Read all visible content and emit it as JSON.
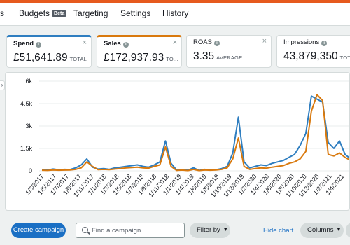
{
  "nav": {
    "items": [
      {
        "label": "s"
      },
      {
        "label": "Budgets",
        "badge": "Beta"
      },
      {
        "label": "Targeting"
      },
      {
        "label": "Settings"
      },
      {
        "label": "History"
      }
    ]
  },
  "metrics": [
    {
      "title": "Spend",
      "value": "£51,641.89",
      "unit": "TOTAL",
      "color": "#2f7ec0"
    },
    {
      "title": "Sales",
      "value": "£172,937.93",
      "unit": "TO...",
      "color": "#d9790d"
    },
    {
      "title": "ROAS",
      "value": "3.35",
      "unit": "AVERAGE"
    },
    {
      "title": "Impressions",
      "value": "43,879,350",
      "unit": "TOTAL"
    }
  ],
  "chart_data": {
    "type": "line",
    "x": [
      "1/3/2017",
      "1/5/2017",
      "1/7/2017",
      "1/9/2017",
      "1/11/2017",
      "1/1/2018",
      "1/3/2018",
      "1/5/2018",
      "1/7/2018",
      "1/9/2018",
      "1/11/2018",
      "1/1/2019",
      "1/4/2019",
      "1/6/2019",
      "1/8/2019",
      "1/10/2019",
      "1/12/2019",
      "1/2/2020",
      "1/4/2020",
      "1/6/2020",
      "1/8/2020",
      "1/10/2020",
      "1/12/2020",
      "1/2/2021",
      "1/4/2021"
    ],
    "series": [
      {
        "color": "#2f7ec0",
        "values": [
          80,
          60,
          120,
          70,
          100,
          90,
          200,
          400,
          800,
          250,
          120,
          150,
          100,
          200,
          250,
          300,
          350,
          400,
          300,
          250,
          400,
          600,
          2000,
          500,
          50,
          80,
          40,
          200,
          30,
          100,
          60,
          80,
          150,
          300,
          1200,
          3600,
          600,
          200,
          300,
          400,
          350,
          500,
          600,
          700,
          900,
          1100,
          1700,
          2500,
          5000,
          4800,
          4600,
          1900,
          1500,
          2000,
          1100,
          800
        ]
      },
      {
        "color": "#d9790d",
        "values": [
          40,
          30,
          60,
          40,
          50,
          60,
          100,
          200,
          600,
          300,
          80,
          100,
          80,
          120,
          150,
          200,
          220,
          250,
          200,
          180,
          300,
          400,
          1600,
          300,
          30,
          50,
          20,
          100,
          20,
          60,
          40,
          60,
          100,
          200,
          800,
          2200,
          300,
          100,
          150,
          200,
          180,
          250,
          300,
          350,
          500,
          600,
          800,
          1300,
          4000,
          5100,
          4700,
          1100,
          1000,
          1200,
          900,
          700
        ]
      }
    ],
    "yticks": [
      "0",
      "1.5k",
      "3k",
      "4.5k",
      "6k"
    ],
    "ylim": [
      0,
      6000
    ]
  },
  "toolbar": {
    "create_label": "Create campaign",
    "search_placeholder": "Find a campaign",
    "filter_label": "Filter by",
    "hide_chart_label": "Hide chart",
    "columns_label": "Columns"
  }
}
